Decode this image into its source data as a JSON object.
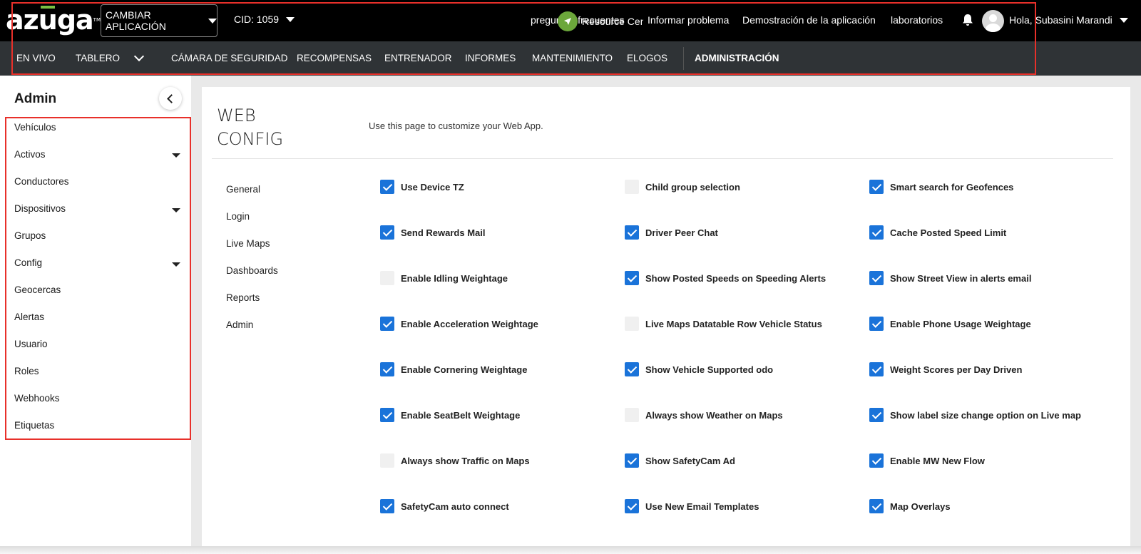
{
  "header": {
    "logo_text": "azuga",
    "logo_tm": "TM",
    "app_switch_label": "CAMBIAR APLICACIÓN",
    "cid_label": "CID: 1059",
    "faq_label": "preguntas frecuentes",
    "resource_center_label": "Resource Center",
    "report_problem_label": "Informar problema",
    "app_demo_label": "Demostración de la aplicación",
    "labs_label": "laboratorios",
    "user_greeting": "Hola, Subasini Marandi"
  },
  "nav": {
    "items": [
      {
        "label": "EN VIVO"
      },
      {
        "label": "TABLERO"
      },
      {
        "label": "CÁMARA DE SEGURIDAD"
      },
      {
        "label": "RECOMPENSAS"
      },
      {
        "label": "ENTRENADOR"
      },
      {
        "label": "INFORMES"
      },
      {
        "label": "MANTENIMIENTO"
      },
      {
        "label": "ELOGOS"
      },
      {
        "label": "ADMINISTRACIÓN"
      }
    ]
  },
  "sidebar": {
    "title": "Admin",
    "items": [
      {
        "label": "Vehículos",
        "expandable": false
      },
      {
        "label": "Activos",
        "expandable": true
      },
      {
        "label": "Conductores",
        "expandable": false
      },
      {
        "label": "Dispositivos",
        "expandable": true
      },
      {
        "label": "Grupos",
        "expandable": false
      },
      {
        "label": "Config",
        "expandable": true
      },
      {
        "label": "Geocercas",
        "expandable": false
      },
      {
        "label": "Alertas",
        "expandable": false
      },
      {
        "label": "Usuario",
        "expandable": false
      },
      {
        "label": "Roles",
        "expandable": false
      },
      {
        "label": "Webhooks",
        "expandable": false
      },
      {
        "label": "Etiquetas",
        "expandable": false
      }
    ]
  },
  "main": {
    "title_line1": "WEB",
    "title_line2": "CONFIG",
    "description": "Use this page to customize your Web App.",
    "sub_nav": [
      {
        "label": "General"
      },
      {
        "label": "Login"
      },
      {
        "label": "Live Maps"
      },
      {
        "label": "Dashboards"
      },
      {
        "label": "Reports"
      },
      {
        "label": "Admin"
      }
    ],
    "columns": [
      [
        {
          "label": "Use Device TZ",
          "checked": true
        },
        {
          "label": "Send Rewards Mail",
          "checked": true
        },
        {
          "label": "Enable Idling Weightage",
          "checked": false
        },
        {
          "label": "Enable Acceleration Weightage",
          "checked": true
        },
        {
          "label": "Enable Cornering Weightage",
          "checked": true
        },
        {
          "label": "Enable SeatBelt Weightage",
          "checked": true
        },
        {
          "label": "Always show Traffic on Maps",
          "checked": false
        },
        {
          "label": "SafetyCam auto connect",
          "checked": true
        }
      ],
      [
        {
          "label": "Child group selection",
          "checked": false
        },
        {
          "label": "Driver Peer Chat",
          "checked": true
        },
        {
          "label": "Show Posted Speeds on Speeding Alerts",
          "checked": true
        },
        {
          "label": "Live Maps Datatable Row Vehicle Status",
          "checked": false
        },
        {
          "label": "Show Vehicle Supported odo",
          "checked": true
        },
        {
          "label": "Always show Weather on Maps",
          "checked": false
        },
        {
          "label": "Show SafetyCam Ad",
          "checked": true
        },
        {
          "label": "Use New Email Templates",
          "checked": true
        }
      ],
      [
        {
          "label": "Smart search for Geofences",
          "checked": true
        },
        {
          "label": "Cache Posted Speed Limit",
          "checked": true
        },
        {
          "label": "Show Street View in alerts email",
          "checked": true
        },
        {
          "label": "Enable Phone Usage Weightage",
          "checked": true
        },
        {
          "label": "Weight Scores per Day Driven",
          "checked": true
        },
        {
          "label": "Show label size change option on Live map",
          "checked": true
        },
        {
          "label": "Enable MW New Flow",
          "checked": true
        },
        {
          "label": "Map Overlays",
          "checked": true
        }
      ]
    ],
    "partial_row": [
      false,
      true,
      true
    ]
  },
  "colors": {
    "topbar": "#000000",
    "navbar": "#2f3336",
    "checkbox_on": "#1a73d9",
    "resource_green": "#6ca73b",
    "annotation_red": "#e8302a"
  }
}
